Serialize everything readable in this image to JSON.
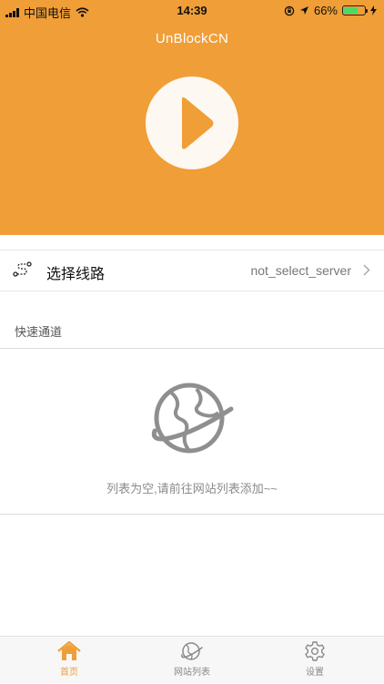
{
  "status_bar": {
    "carrier": "中国电信",
    "time": "14:39",
    "battery": "66%",
    "battery_level": 0.66
  },
  "header": {
    "title": "UnBlockCN",
    "play_icon": "play-icon",
    "background_color": "#f09e37"
  },
  "route": {
    "label": "选择线路",
    "value": "not_select_server",
    "icon": "route-icon"
  },
  "quick_channel": {
    "title": "快速通道",
    "empty_text": "列表为空,请前往网站列表添加~~",
    "empty_icon": "globe-icon"
  },
  "tabbar": {
    "items": [
      {
        "label": "首页",
        "icon": "home-icon",
        "active": true
      },
      {
        "label": "网站列表",
        "icon": "globe-icon",
        "active": false
      },
      {
        "label": "设置",
        "icon": "gear-icon",
        "active": false
      }
    ],
    "active_color": "#f09e37"
  }
}
